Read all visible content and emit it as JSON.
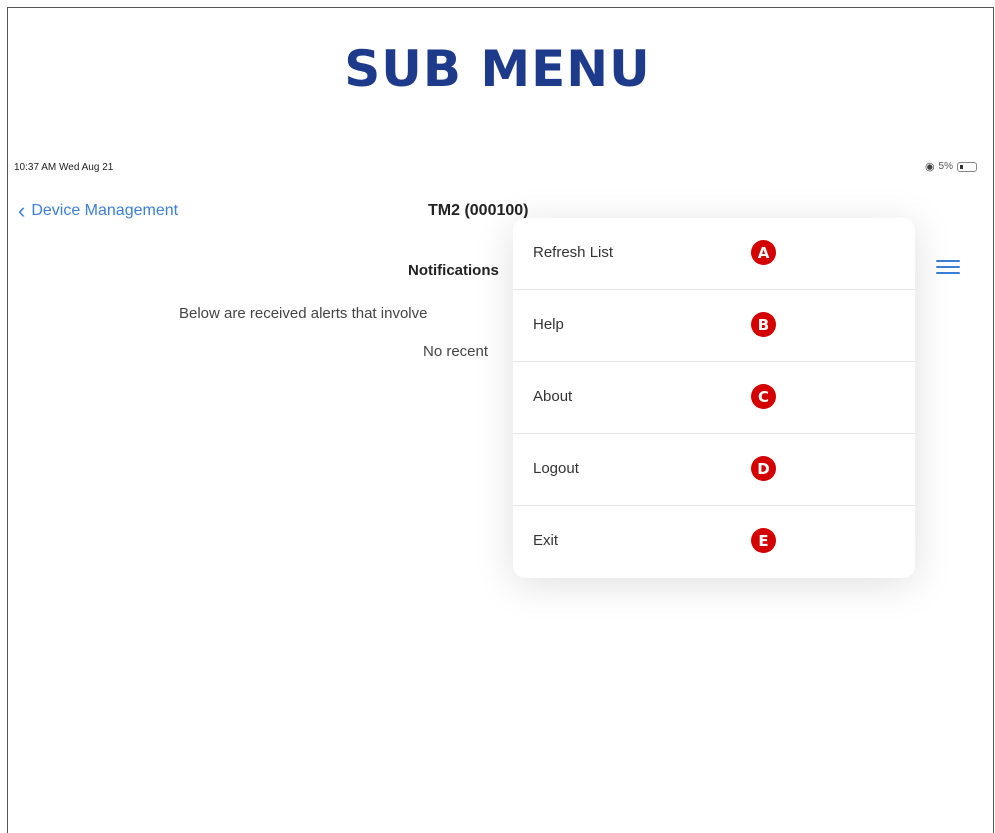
{
  "page_title": "SUB MENU",
  "status_bar": {
    "time": "10:37 AM  Wed Aug 21",
    "battery": "5%"
  },
  "nav": {
    "back_label": "Device Management",
    "title": "TM2 (000100)"
  },
  "content": {
    "section_title": "Notifications",
    "description": "Below are received alerts that involve",
    "empty_state": "No recent"
  },
  "menu": {
    "items": [
      {
        "label": "Refresh List",
        "badge": "A"
      },
      {
        "label": "Help",
        "badge": "B"
      },
      {
        "label": "About",
        "badge": "C"
      },
      {
        "label": "Logout",
        "badge": "D"
      },
      {
        "label": "Exit",
        "badge": "E"
      }
    ]
  },
  "colors": {
    "title": "#1e3a8a",
    "accent": "#3b7fd9",
    "badge": "#d40000"
  },
  "icons": [
    "chevron-left-icon",
    "hamburger-menu-icon",
    "wifi-icon",
    "battery-icon"
  ]
}
